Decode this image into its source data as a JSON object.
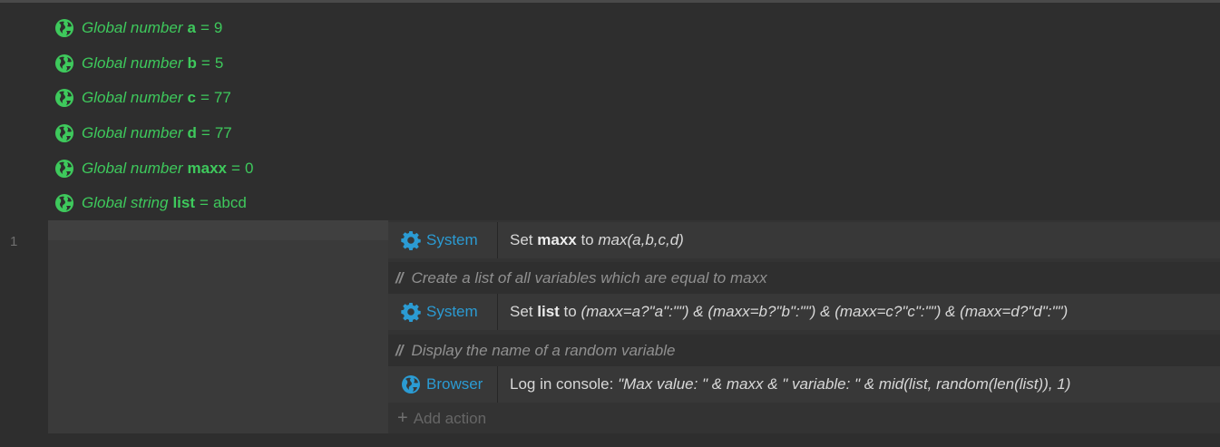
{
  "globals": [
    {
      "kind": "Global number",
      "name": "a",
      "value": "9"
    },
    {
      "kind": "Global number",
      "name": "b",
      "value": "5"
    },
    {
      "kind": "Global number",
      "name": "c",
      "value": "77"
    },
    {
      "kind": "Global number",
      "name": "d",
      "value": "77"
    },
    {
      "kind": "Global number",
      "name": "maxx",
      "value": "0"
    },
    {
      "kind": "Global string",
      "name": "list",
      "value": "abcd"
    }
  ],
  "event": {
    "line_number": "1",
    "actions": [
      {
        "object": "System",
        "prefix": "Set ",
        "var": "maxx",
        "mid": " to ",
        "expr": "max(a,b,c,d)"
      },
      {
        "comment": "Create a list of all variables which are equal to maxx"
      },
      {
        "object": "System",
        "prefix": "Set ",
        "var": "list",
        "mid": " to ",
        "expr": "(maxx=a?\"a\":\"\") & (maxx=b?\"b\":\"\") & (maxx=c?\"c\":\"\") & (maxx=d?\"d\":\"\")"
      },
      {
        "comment": "Display the name of a random variable"
      },
      {
        "object": "Browser",
        "prefix": "Log in console: ",
        "expr": "\"Max value: \" & maxx & \" variable: \" & mid(list, random(len(list)), 1)"
      }
    ],
    "add_action_label": "Add action",
    "comment_marker": "//"
  },
  "icons": {
    "global": "globe-icon",
    "system": "gear-icon",
    "browser": "globe-icon",
    "add": "plus-icon"
  },
  "colors": {
    "global_text": "#3ec95c",
    "object_text": "#2b9bd3",
    "background": "#2e2e2e"
  }
}
